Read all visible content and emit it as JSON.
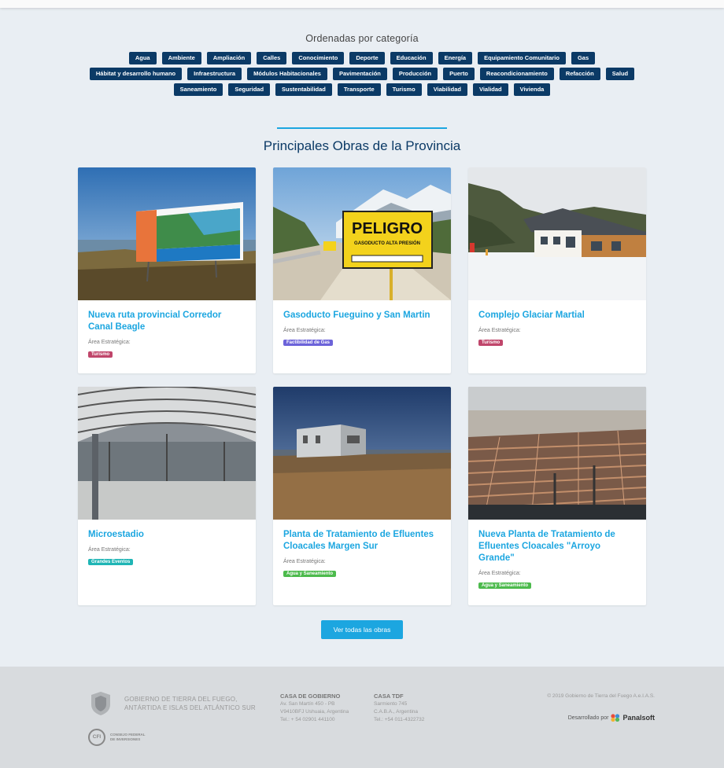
{
  "categories": {
    "heading": "Ordenadas por categoría",
    "rows": [
      [
        "Agua",
        "Ambiente",
        "Ampliación",
        "Calles",
        "Conocimiento",
        "Deporte",
        "Educación",
        "Energía",
        "Equipamiento Comunitario",
        "Gas"
      ],
      [
        "Hábitat y desarrollo humano",
        "Infraestructura",
        "Módulos Habitacionales",
        "Pavimentación",
        "Producción",
        "Puerto",
        "Reacondicionamiento",
        "Refacción",
        "Salud"
      ],
      [
        "Saneamiento",
        "Seguridad",
        "Sustentabilidad",
        "Transporte",
        "Turismo",
        "Viabilidad",
        "Vialidad",
        "Vivienda"
      ]
    ]
  },
  "works": {
    "title": "Principales Obras de la Provincia",
    "area_label": "Área Estratégica:",
    "items": [
      {
        "title": "Nueva ruta provincial Corredor Canal Beagle",
        "badge": "Turismo",
        "badge_color": "#c0466b"
      },
      {
        "title": "Gasoducto Fueguino y San Martin",
        "badge": "Factibilidad de Gas",
        "badge_color": "#6c63d9"
      },
      {
        "title": "Complejo Glaciar Martial",
        "badge": "Turismo",
        "badge_color": "#c0466b"
      },
      {
        "title": "Microestadio",
        "badge": "Grandes Eventos",
        "badge_color": "#1fb5b5"
      },
      {
        "title": "Planta de Tratamiento de Efluentes Cloacales Margen Sur",
        "badge": "Agua y Saneamiento",
        "badge_color": "#4cba4c"
      },
      {
        "title": "Nueva Planta de Tratamiento de Efluentes Cloacales \"Arroyo Grande\"",
        "badge": "Agua y Saneamiento",
        "badge_color": "#4cba4c"
      }
    ],
    "sign_text": "PELIGRO",
    "sign_sub": "GASODUCTO ALTA PRESIÓN",
    "button": "Ver todas las obras"
  },
  "footer": {
    "gov_line1": "GOBIERNO DE TIERRA DEL FUEGO,",
    "gov_line2": "ANTÁRTIDA E ISLAS DEL ATLÁNTICO SUR",
    "cfi_logo": "CFI",
    "cfi_line1": "CONSEJO FEDERAL",
    "cfi_line2": "DE INVERSIONES",
    "casa_gob_title": "CASA DE GOBIERNO",
    "casa_gob_l1": "Av. San Martín 450 - PB",
    "casa_gob_l2": "V9410BFJ Ushuaia, Argentina",
    "casa_gob_l3": "Tel.: + 54 02901 441100",
    "casa_tdf_title": "CASA TDF",
    "casa_tdf_l1": "Sarmiento 745",
    "casa_tdf_l2": "C.A.B.A., Argentina",
    "casa_tdf_l3": "Tel.: +54 011-4322732",
    "copyright": "© 2019 Gobierno de Tierra del Fuego A.e.I.A.S.",
    "dev_label": "Desarrollado por",
    "dev_name": "Panalsoft"
  }
}
